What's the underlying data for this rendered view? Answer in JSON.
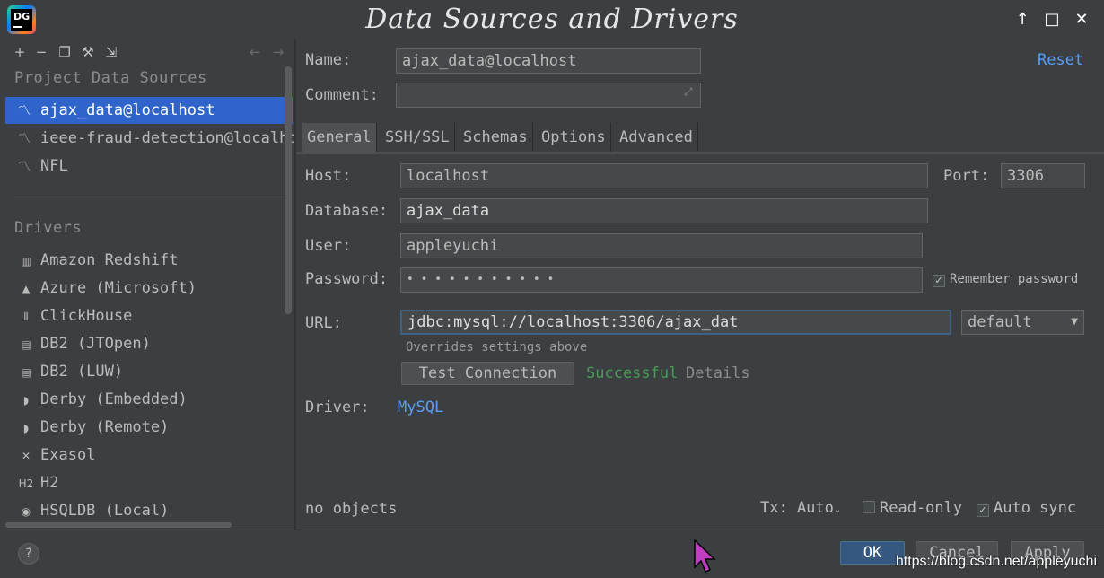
{
  "window": {
    "title": "Data Sources and Drivers",
    "logo_text": "DG"
  },
  "left": {
    "project_title": "Project Data Sources",
    "data_sources": [
      {
        "label": "ajax_data@localhost",
        "selected": true
      },
      {
        "label": "ieee-fraud-detection@localhost"
      },
      {
        "label": "NFL"
      }
    ],
    "drivers_title": "Drivers",
    "drivers": [
      {
        "label": "Amazon Redshift",
        "icon": "redshift-icon",
        "glyph": "▥"
      },
      {
        "label": "Azure (Microsoft)",
        "icon": "azure-icon",
        "glyph": "▲"
      },
      {
        "label": "ClickHouse",
        "icon": "clickhouse-icon",
        "glyph": "⦀"
      },
      {
        "label": "DB2 (JTOpen)",
        "icon": "db2-icon",
        "glyph": "▤"
      },
      {
        "label": "DB2 (LUW)",
        "icon": "db2-icon",
        "glyph": "▤"
      },
      {
        "label": "Derby (Embedded)",
        "icon": "derby-icon",
        "glyph": "◗"
      },
      {
        "label": "Derby (Remote)",
        "icon": "derby-icon",
        "glyph": "◗"
      },
      {
        "label": "Exasol",
        "icon": "exasol-icon",
        "glyph": "✕"
      },
      {
        "label": "H2",
        "icon": "h2-icon",
        "glyph": "H2"
      },
      {
        "label": "HSQLDB (Local)",
        "icon": "hsqldb-icon",
        "glyph": "◉"
      }
    ]
  },
  "form": {
    "name_label": "Name:",
    "name_value": "ajax_data@localhost",
    "reset_label": "Reset",
    "comment_label": "Comment:",
    "comment_value": "",
    "tabs": [
      "General",
      "SSH/SSL",
      "Schemas",
      "Options",
      "Advanced"
    ],
    "host_label": "Host:",
    "host_value": "localhost",
    "port_label": "Port:",
    "port_value": "3306",
    "database_label": "Database:",
    "database_value": "ajax_data",
    "user_label": "User:",
    "user_value": "appleyuchi",
    "password_label": "Password:",
    "password_value": "• • • • • • • • • • •",
    "remember_label": "Remember password",
    "url_label": "URL:",
    "url_value": "jdbc:mysql://localhost:3306/ajax_dat",
    "url_mode": "default",
    "overrides_note": "Overrides settings above",
    "test_button": "Test Connection",
    "test_status": "Successful",
    "details_link": "Details",
    "driver_label": "Driver:",
    "driver_value": "MySQL",
    "objects_status": "no objects",
    "tx_label": "Tx: Auto",
    "readonly_label": "Read-only",
    "autosync_label": "Auto sync"
  },
  "footer": {
    "help": "?",
    "ok": "OK",
    "cancel": "Cancel",
    "apply": "Apply",
    "watermark": "https://blog.csdn.net/appleyuchi"
  },
  "colors": {
    "accent": "#2f65ca",
    "success": "#499c54",
    "link": "#589df6"
  }
}
